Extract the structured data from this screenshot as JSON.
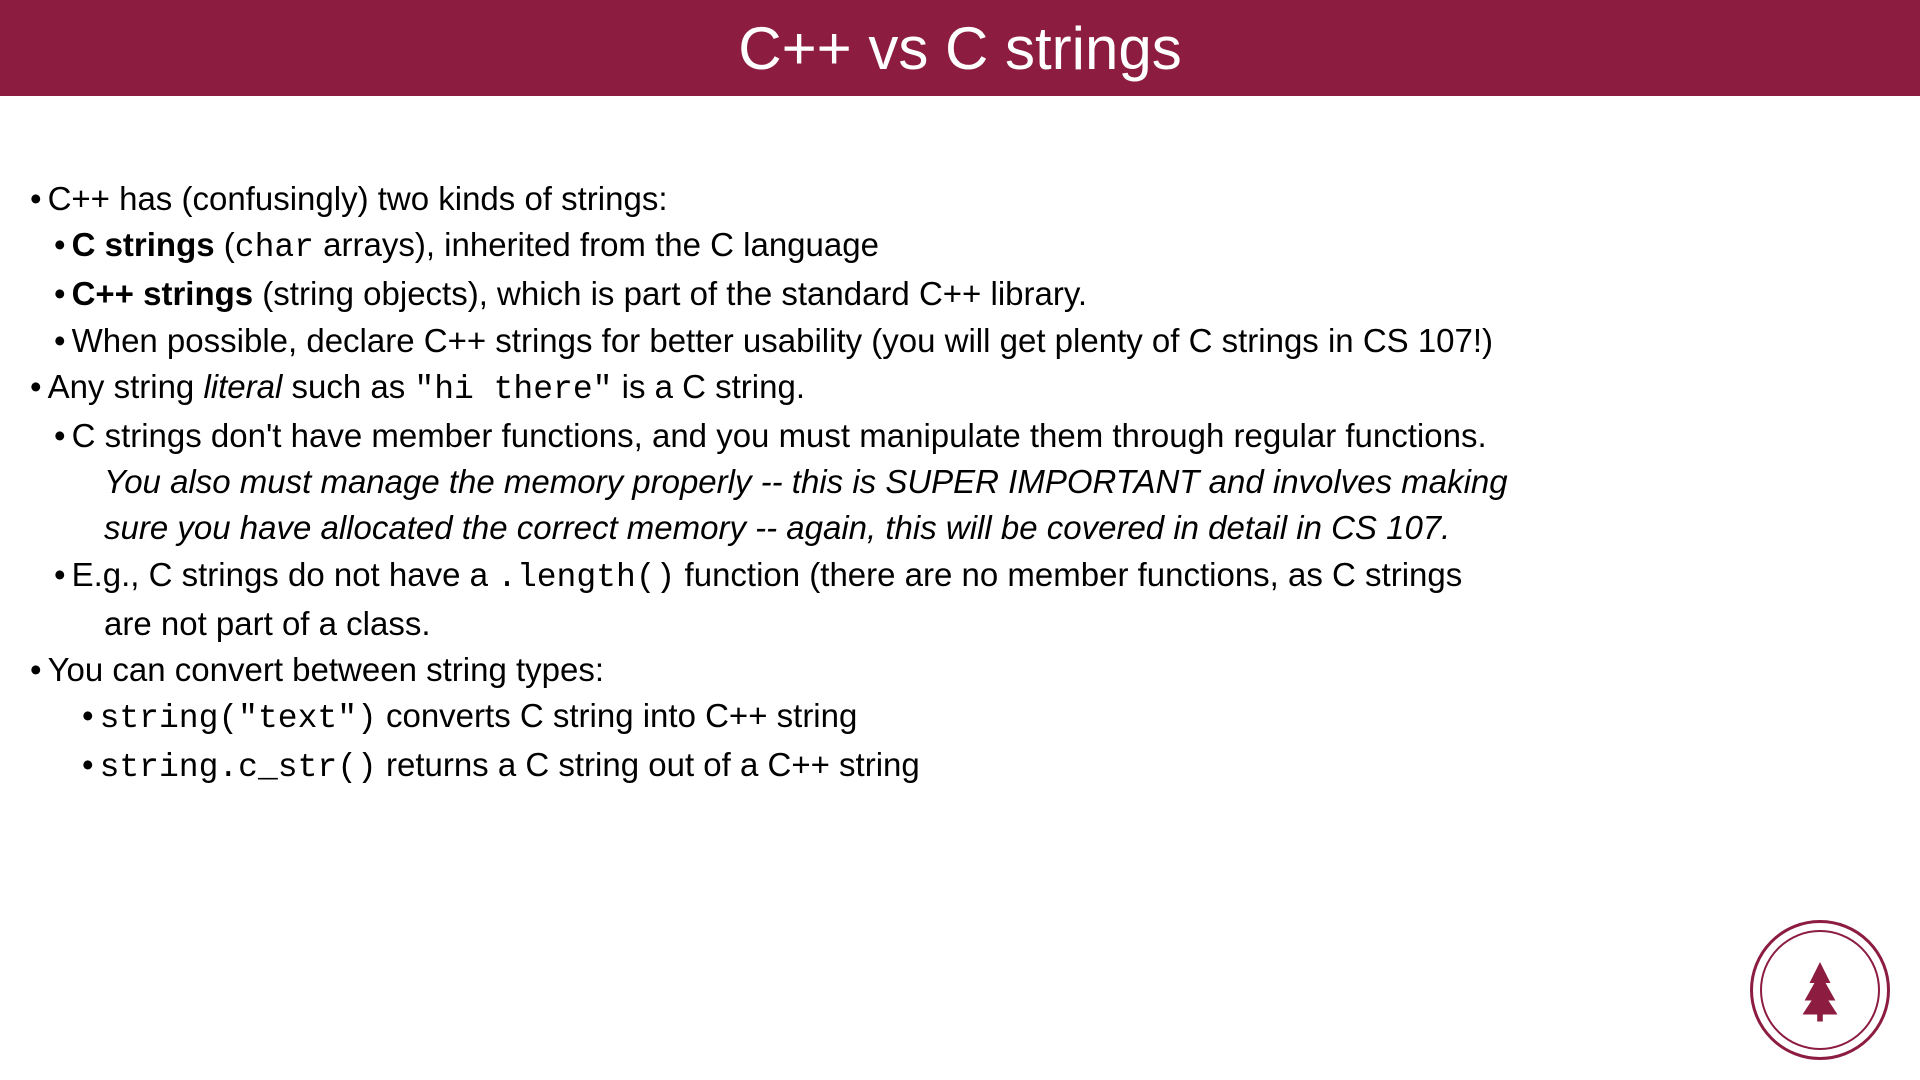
{
  "header": {
    "title": "C++ vs C strings"
  },
  "bullets": {
    "b1": "C++ has (confusingly) two kinds of strings:",
    "b1a_bold": "C strings",
    "b1a_open": " (",
    "b1a_code": "char",
    "b1a_rest": " arrays), inherited from the C language",
    "b1b_bold": "C++ strings",
    "b1b_rest": " (string objects), which is part of the standard C++ library.",
    "b1c": "When possible, declare C++ strings for better usability (you will get plenty of C strings in CS 107!)",
    "b2_pre": "Any string ",
    "b2_italic": "literal",
    "b2_mid": " such as ",
    "b2_code": "\"hi there\"",
    "b2_post": " is a C string.",
    "b2a": "C strings don't have member functions, and you must manipulate them through regular functions.",
    "b2a_italic1": "You also must manage the memory properly -- this is SUPER IMPORTANT and involves making",
    "b2a_italic2": "sure you have allocated the correct memory -- again, this will be covered in detail in CS 107.",
    "b2b_pre": "E.g., C strings do not have a ",
    "b2b_code": ".length()",
    "b2b_post": " function (there are no member functions, as C strings",
    "b2b_cont": "are not part of a class.",
    "b3": "You can convert between string types:",
    "b3a_code": "string(\"text\")",
    "b3a_rest": " converts C string into C++ string",
    "b3b_code": "string.c_str()",
    "b3b_rest": " returns a C string out of a C++ string"
  },
  "logo": {
    "name": "stanford-seal"
  },
  "colors": {
    "brand": "#8c1d40"
  }
}
